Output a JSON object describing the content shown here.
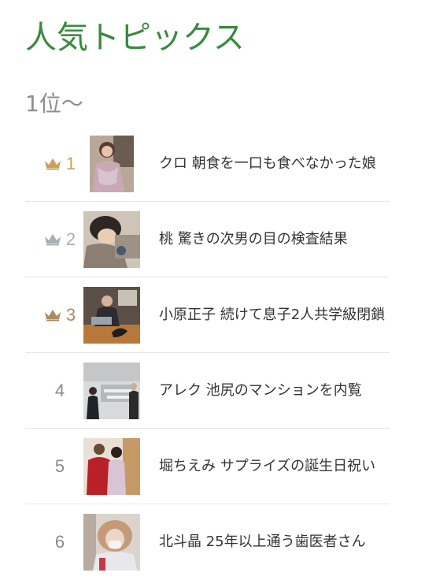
{
  "header": {
    "title": "人気トピックス",
    "subtitle": "1位〜"
  },
  "colors": {
    "title": "#3a8a3f",
    "gold": "#c8a060",
    "silver": "#a8b0b4",
    "bronze": "#b08a60",
    "rank_text": "#8a8a8a"
  },
  "topics": [
    {
      "rank": "1",
      "crown": "gold-crown-icon",
      "text": "クロ 朝食を一口も食べなかった娘"
    },
    {
      "rank": "2",
      "crown": "silver-crown-icon",
      "text": "桃 驚きの次男の目の検査結果"
    },
    {
      "rank": "3",
      "crown": "bronze-crown-icon",
      "text": "小原正子 続けて息子2人共学級閉鎖"
    },
    {
      "rank": "4",
      "crown": null,
      "text": "アレク 池尻のマンションを内覧"
    },
    {
      "rank": "5",
      "crown": null,
      "text": "堀ちえみ サプライズの誕生日祝い"
    },
    {
      "rank": "6",
      "crown": null,
      "text": "北斗晶 25年以上通う歯医者さん"
    }
  ]
}
